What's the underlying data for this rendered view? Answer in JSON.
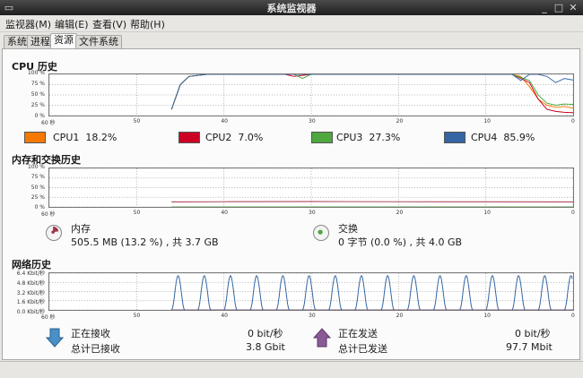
{
  "window": {
    "title": "系统监视器"
  },
  "menu": [
    "监视器(M)",
    "编辑(E)",
    "查看(V)",
    "帮助(H)"
  ],
  "tabs": [
    "系统",
    "进程",
    "资源",
    "文件系统"
  ],
  "cpu": {
    "title": "CPU 历史",
    "y_ticks": [
      "100 %",
      "75 %",
      "50 %",
      "25 %",
      "0 %"
    ],
    "x_ticks": [
      "60 秒",
      "50",
      "40",
      "30",
      "20",
      "10",
      "0"
    ],
    "legend": [
      {
        "name": "CPU1",
        "value": "18.2%",
        "color": "#f57900"
      },
      {
        "name": "CPU2",
        "value": "7.0%",
        "color": "#cc0023"
      },
      {
        "name": "CPU3",
        "value": "27.3%",
        "color": "#4ea83e"
      },
      {
        "name": "CPU4",
        "value": "85.9%",
        "color": "#3465a4"
      }
    ]
  },
  "memory": {
    "title": "内存和交换历史",
    "y_ticks": [
      "100 %",
      "75 %",
      "50 %",
      "25 %",
      "0 %"
    ],
    "x_ticks": [
      "60 秒",
      "50",
      "40",
      "30",
      "20",
      "10",
      "0"
    ],
    "mem_label": "内存",
    "mem_value": "505.5 MB (13.2 %) , 共 3.7 GB",
    "swap_label": "交换",
    "swap_value": "0 字节 (0.0 %) , 共 4.0 GB"
  },
  "network": {
    "title": "网络历史",
    "y_ticks": [
      "6.4 Kbit/秒",
      "4.8 Kbit/秒",
      "3.2 Kbit/秒",
      "1.6 Kbit/秒",
      "0.0 Kbit/秒"
    ],
    "x_ticks": [
      "60 秒",
      "50",
      "40",
      "30",
      "20",
      "10",
      "0"
    ],
    "recv_label": "正在接收",
    "recv_rate": "0 bit/秒",
    "recv_total_label": "总计已接收",
    "recv_total": "3.8 Gbit",
    "send_label": "正在发送",
    "send_rate": "0 bit/秒",
    "send_total_label": "总计已发送",
    "send_total": "97.7 Mbit"
  },
  "chart_data": [
    {
      "type": "line",
      "title": "CPU 历史",
      "xlabel": "",
      "ylabel": "",
      "xlim": [
        60,
        0
      ],
      "ylim": [
        0,
        100
      ],
      "grid": true,
      "series": [
        {
          "name": "CPU1",
          "color": "#f57900",
          "x": [
            46,
            45,
            44,
            42,
            30,
            20,
            10,
            7,
            6,
            5,
            4,
            3,
            2,
            1,
            0
          ],
          "values": [
            15,
            75,
            95,
            100,
            100,
            100,
            100,
            100,
            95,
            70,
            40,
            25,
            20,
            22,
            18
          ]
        },
        {
          "name": "CPU2",
          "color": "#cc0023",
          "x": [
            46,
            45,
            44,
            42,
            33,
            32,
            30,
            20,
            10,
            7,
            5,
            4,
            3,
            2,
            1,
            0
          ],
          "values": [
            15,
            75,
            95,
            100,
            100,
            95,
            100,
            100,
            100,
            100,
            80,
            40,
            15,
            10,
            8,
            7
          ]
        },
        {
          "name": "CPU3",
          "color": "#4ea83e",
          "x": [
            46,
            45,
            44,
            42,
            32,
            31,
            30,
            20,
            10,
            7,
            5,
            4,
            3,
            2,
            1,
            0
          ],
          "values": [
            15,
            75,
            95,
            100,
            100,
            90,
            100,
            100,
            100,
            100,
            85,
            50,
            30,
            25,
            28,
            27
          ]
        },
        {
          "name": "CPU4",
          "color": "#3465a4",
          "x": [
            46,
            45,
            44,
            42,
            30,
            20,
            10,
            7,
            6,
            5,
            4,
            3,
            2,
            1,
            0
          ],
          "values": [
            15,
            75,
            95,
            100,
            100,
            100,
            100,
            100,
            85,
            100,
            100,
            95,
            80,
            90,
            86
          ]
        }
      ]
    },
    {
      "type": "line",
      "title": "内存和交换历史",
      "xlim": [
        60,
        0
      ],
      "ylim": [
        0,
        100
      ],
      "grid": true,
      "series": [
        {
          "name": "内存",
          "color": "#a0324a",
          "x": [
            46,
            40,
            30,
            20,
            10,
            0
          ],
          "values": [
            13,
            13.5,
            14,
            13.5,
            13.3,
            13.2
          ]
        },
        {
          "name": "交换",
          "color": "#4ea83e",
          "x": [
            46,
            0
          ],
          "values": [
            0,
            0
          ]
        }
      ]
    },
    {
      "type": "line",
      "title": "网络历史",
      "xlim": [
        60,
        0
      ],
      "ylim": [
        0,
        6.4
      ],
      "grid": true,
      "series": [
        {
          "name": "正在接收",
          "color": "#3465a4",
          "x": [
            46,
            0
          ],
          "values": [
            0,
            0
          ],
          "pulse_peak_kbit": 6.0,
          "pulse_period_s": 3.0
        },
        {
          "name": "正在发送",
          "color": "#75507b",
          "x": [
            46,
            0
          ],
          "values": [
            0,
            0
          ]
        }
      ]
    }
  ]
}
